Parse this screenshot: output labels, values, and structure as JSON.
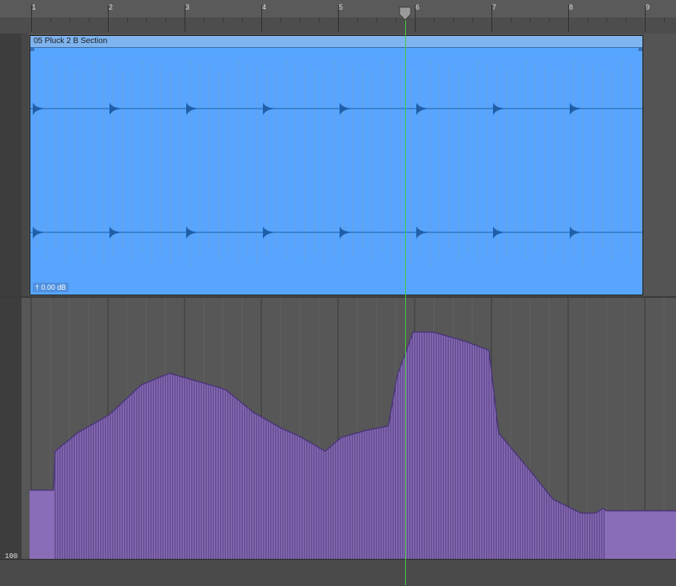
{
  "timeline": {
    "bars": [
      "1",
      "2",
      "3",
      "4",
      "5",
      "6",
      "7",
      "8",
      "9"
    ],
    "playhead_bar": 5.85
  },
  "region": {
    "name": "05 Pluck 2 B Section",
    "gain": "0.00 dB",
    "color": "#57a5ff",
    "waveform_color": "#1f5ea8"
  },
  "automation": {
    "scale_label": "100",
    "color": "#8a6db8",
    "dark_color": "#4b3776",
    "curve_description_levels": [
      0.3,
      0.47,
      0.78,
      0.55,
      0.52,
      0.99,
      0.54,
      0.21
    ]
  },
  "colors": {
    "playhead": "#47c83e",
    "background": "#4e4e4e"
  },
  "icons": {
    "gain": "dagger-icon",
    "playhead": "playhead-marker-icon"
  }
}
